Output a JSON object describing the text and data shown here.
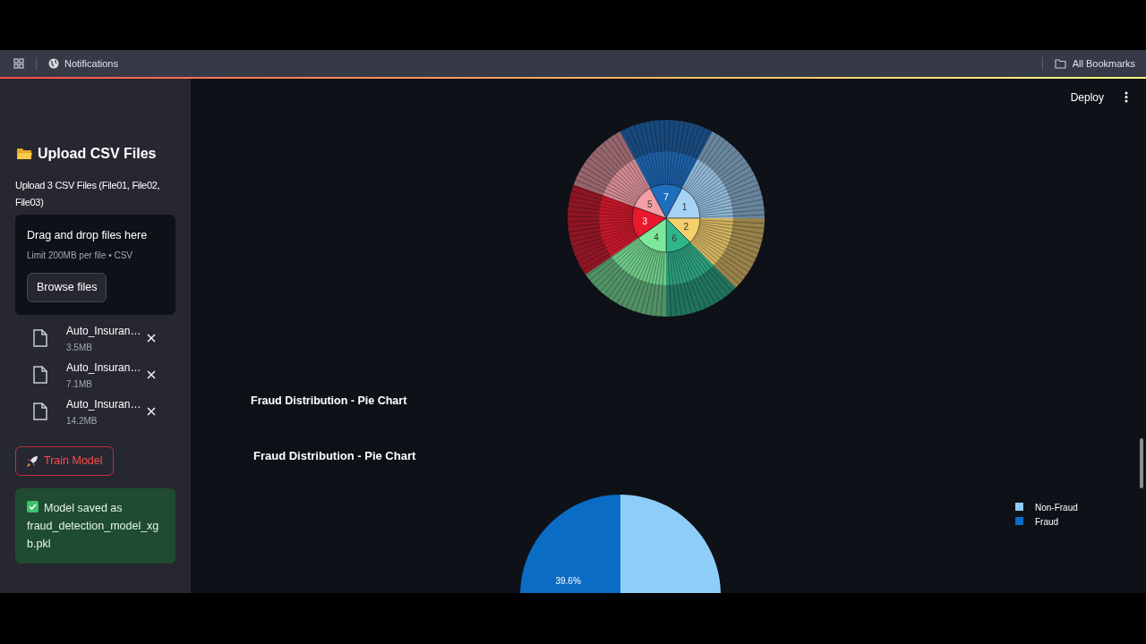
{
  "browser_bar": {
    "tab": "Notifications",
    "bookmarks": "All Bookmarks"
  },
  "sidebar": {
    "heading": "Upload CSV Files",
    "upload_label": "Upload 3 CSV Files (File01, File02, File03)",
    "dropzone": {
      "title": "Drag and drop files here",
      "hint": "Limit 200MB per file • CSV",
      "button": "Browse files"
    },
    "files": [
      {
        "name": "Auto_Insuran…",
        "size": "3.5MB"
      },
      {
        "name": "Auto_Insuran…",
        "size": "7.1MB"
      },
      {
        "name": "Auto_Insuran…",
        "size": "14.2MB"
      }
    ],
    "train_button": "Train Model",
    "success": "Model saved as fraud_detection_model_xgb.pkl"
  },
  "header": {
    "deploy": "Deploy"
  },
  "sunburst": {
    "segments": [
      {
        "label": "7",
        "color": "#1f6fbf"
      },
      {
        "label": "1",
        "color": "#a6d3f5"
      },
      {
        "label": "2",
        "color": "#f5cf6b"
      },
      {
        "label": "6",
        "color": "#2fb58a"
      },
      {
        "label": "4",
        "color": "#7ee89a"
      },
      {
        "label": "3",
        "color": "#e8192c"
      },
      {
        "label": "5",
        "color": "#f29fa5"
      }
    ]
  },
  "section_title": "Fraud Distribution - Pie Chart",
  "pie": {
    "chart_data": {
      "type": "pie",
      "title": "Fraud Distribution - Pie Chart",
      "categories": [
        "Non-Fraud",
        "Fraud"
      ],
      "series": [
        {
          "color": [
            "#8ecdf7",
            "#0a6cc4"
          ],
          "values": [
            60.4,
            39.6
          ]
        }
      ],
      "legend": true,
      "value_labels": [
        null,
        "39.6%"
      ]
    }
  }
}
